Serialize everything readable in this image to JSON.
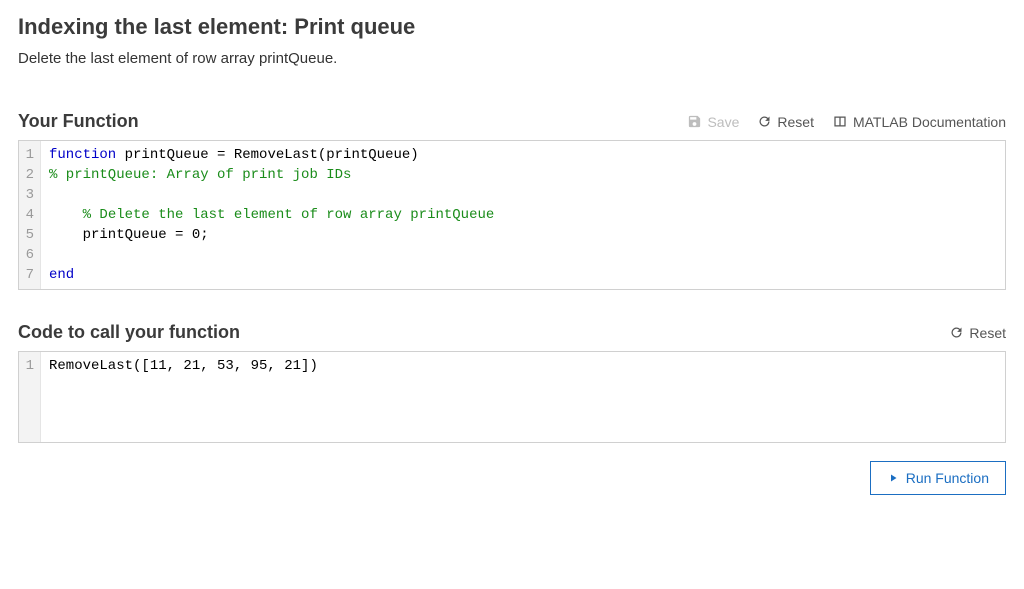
{
  "page": {
    "title": "Indexing the last element: Print queue",
    "instructions": "Delete the last element of row array printQueue."
  },
  "yourFunction": {
    "heading": "Your Function",
    "toolbar": {
      "save": "Save",
      "reset": "Reset",
      "docs": "MATLAB Documentation"
    },
    "code": {
      "lines": [
        {
          "tokens": [
            {
              "cls": "tok-keyword",
              "text": "function"
            },
            {
              "cls": "tok-default",
              "text": " printQueue = RemoveLast(printQueue)"
            }
          ]
        },
        {
          "tokens": [
            {
              "cls": "tok-comment",
              "text": "% printQueue: Array of print job IDs"
            }
          ]
        },
        {
          "tokens": [
            {
              "cls": "tok-default",
              "text": ""
            }
          ]
        },
        {
          "tokens": [
            {
              "cls": "tok-default",
              "text": "    "
            },
            {
              "cls": "tok-comment",
              "text": "% Delete the last element of row array printQueue"
            }
          ]
        },
        {
          "tokens": [
            {
              "cls": "tok-default",
              "text": "    printQueue = 0;"
            }
          ]
        },
        {
          "tokens": [
            {
              "cls": "tok-default",
              "text": ""
            }
          ]
        },
        {
          "tokens": [
            {
              "cls": "tok-keyword",
              "text": "end"
            }
          ]
        }
      ]
    }
  },
  "callFunction": {
    "heading": "Code to call your function",
    "toolbar": {
      "reset": "Reset"
    },
    "code": {
      "lines": [
        {
          "tokens": [
            {
              "cls": "tok-default",
              "text": "RemoveLast([11, 21, 53, 95, 21])"
            }
          ]
        }
      ]
    }
  },
  "runButton": {
    "label": "Run Function"
  }
}
